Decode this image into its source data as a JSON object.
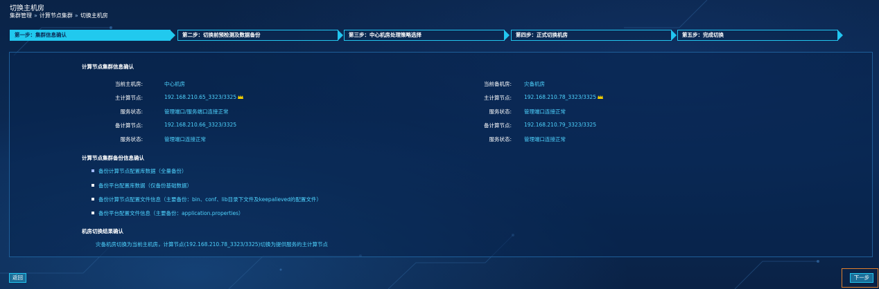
{
  "header": {
    "title": "切换主机房"
  },
  "breadcrumb": [
    {
      "label": "集群管理"
    },
    {
      "label": "计算节点集群"
    },
    {
      "label": "切换主机房"
    }
  ],
  "breadcrumb_separator": "»",
  "steps": [
    {
      "label": "第一步：集群信息确认"
    },
    {
      "label": "第二步：切换前预检测及数据备份"
    },
    {
      "label": "第三步：中心机房处理策略选择"
    },
    {
      "label": "第四步：正式切换机房"
    },
    {
      "label": "第五步：完成切换"
    }
  ],
  "cluster_info": {
    "title": "计算节点集群信息确认",
    "left": {
      "current_room_label": "当前主机房:",
      "current_room_value": "中心机房",
      "master_label": "主计算节点:",
      "master_value": "192.168.210.65_3323/3325",
      "master_status_label": "服务状态:",
      "master_status_value": "管理端口/服务端口连接正常",
      "backup_label": "备计算节点:",
      "backup_value": "192.168.210.66_3323/3325",
      "backup_status_label": "服务状态:",
      "backup_status_value": "管理端口连接正常"
    },
    "right": {
      "current_room_label": "当前备机房:",
      "current_room_value": "灾备机房",
      "master_label": "主计算节点:",
      "master_value": "192.168.210.78_3323/3325",
      "master_status_label": "服务状态:",
      "master_status_value": "管理端口连接正常",
      "backup_label": "备计算节点:",
      "backup_value": "192.168.210.79_3323/3325",
      "backup_status_label": "服务状态:",
      "backup_status_value": "管理端口连接正常"
    },
    "crown_icon": "crown-icon"
  },
  "backup_info": {
    "title": "计算节点集群备份信息确认",
    "items": [
      "备份计算节点配置库数据（全量备份）",
      "备份平台配置库数据（仅备份基础数据）",
      "备份计算节点配置文件信息（主要备份：bin、conf、lib目录下文件及keepalieved的配置文件）",
      "备份平台配置文件信息（主要备份：application.properties）"
    ]
  },
  "result": {
    "title": "机房切换结果确认",
    "text": "灾备机房切换为当前主机房，计算节点(192.168.210.78_3323/3325)切换为提供服务的主计算节点"
  },
  "buttons": {
    "back": "返回",
    "next": "下一步"
  },
  "colors": {
    "accent": "#21c9ee",
    "value": "#4fd4ff",
    "focus": "#e4812c",
    "crown": "#f5d000"
  }
}
